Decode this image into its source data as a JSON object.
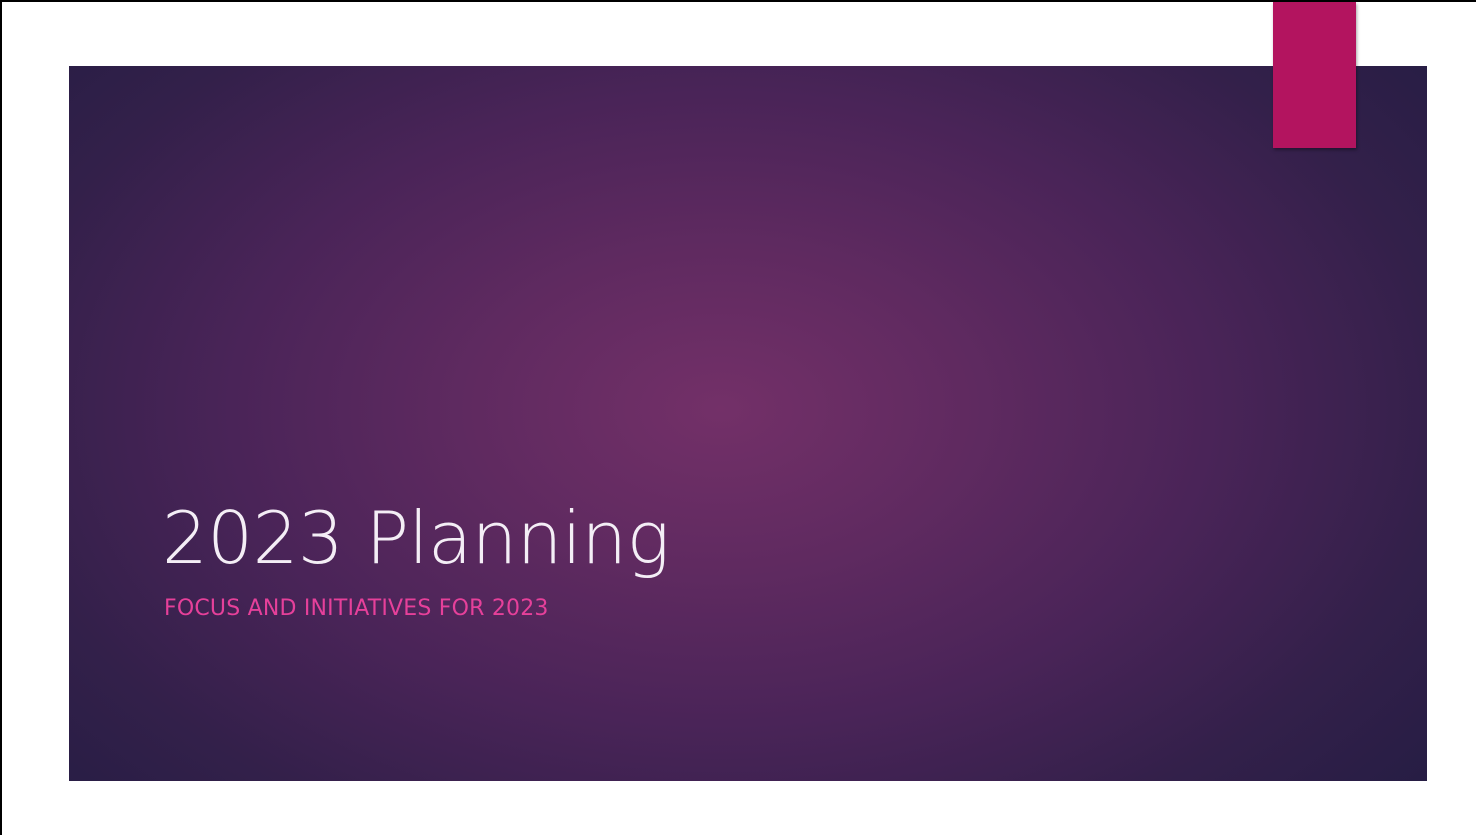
{
  "slide": {
    "title": "2023 Planning",
    "subtitle": "FOCUS AND INITIATIVES FOR 2023"
  },
  "colors": {
    "background_center": "#733068",
    "background_edge": "#221c42",
    "accent_tab": "#b3145f",
    "title_text": "#f4eef6",
    "subtitle_text": "#e6409a"
  }
}
